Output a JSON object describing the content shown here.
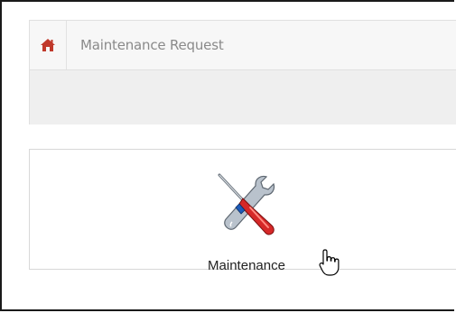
{
  "breadcrumb": {
    "home_icon": "home-icon",
    "title": "Maintenance Request"
  },
  "tiles": [
    {
      "icon": "tools-icon",
      "label": "Maintenance"
    }
  ],
  "colors": {
    "home_icon": "#c0392b",
    "breadcrumb_text": "#8a8a8a",
    "header_bg": "#f7f7f7",
    "subbar_bg": "#efefef"
  }
}
